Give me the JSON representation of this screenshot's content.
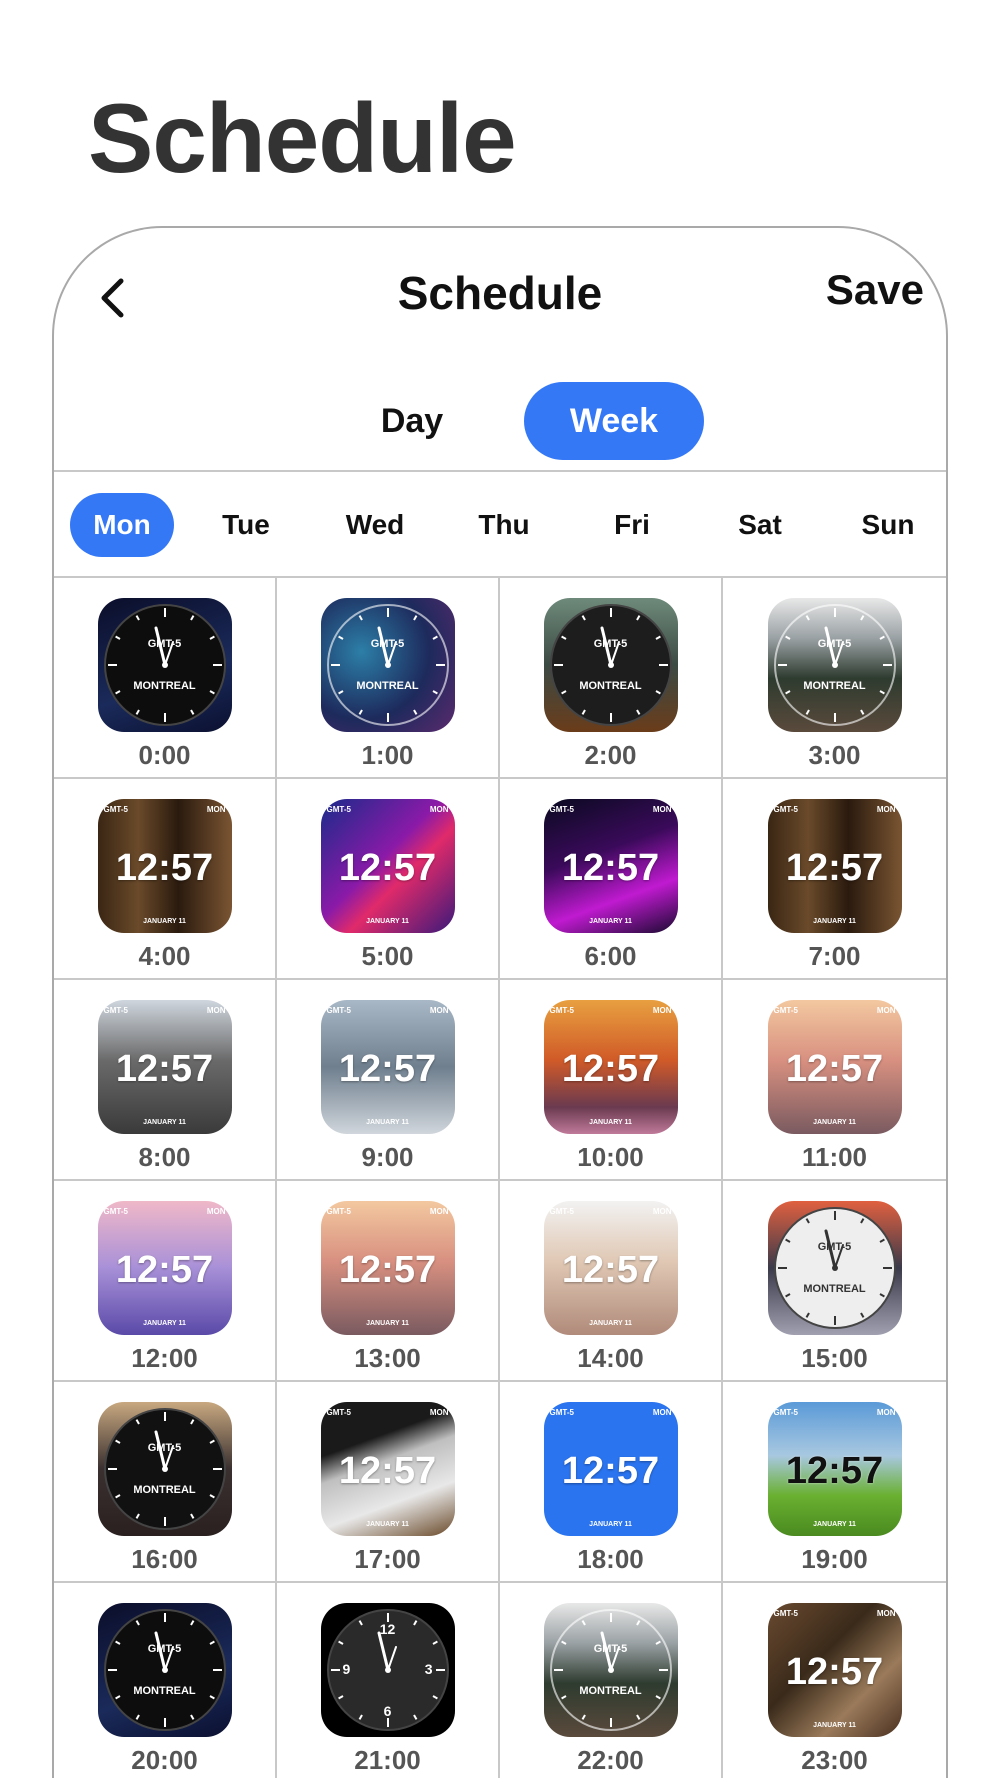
{
  "page_title": "Schedule",
  "nav": {
    "title": "Schedule",
    "save_label": "Save"
  },
  "segment": {
    "day_label": "Day",
    "week_label": "Week",
    "selected": "Week"
  },
  "days": [
    "Mon",
    "Tue",
    "Wed",
    "Thu",
    "Fri",
    "Sat",
    "Sun"
  ],
  "selected_day": "Mon",
  "face_text": {
    "zone": "GMT-5",
    "city": "MONTREAL",
    "city_short": "MON",
    "time": "12:57",
    "date": "JANUARY 11",
    "num_12": "12",
    "num_3": "3",
    "num_6": "6",
    "num_9": "9"
  },
  "slots": [
    {
      "time": "0:00",
      "style": "analog",
      "bg": "linear-gradient(160deg,#0b0e2a,#1a2a5a 60%,#0b1030)",
      "dial": "#0d0d0d"
    },
    {
      "time": "1:00",
      "style": "analog",
      "bg": "radial-gradient(circle at 30% 40%,#2c7fa8,#1d2a5c 55%,#5b2a6e)",
      "dial": "transparent"
    },
    {
      "time": "2:00",
      "style": "analog",
      "bg": "linear-gradient(180deg,#6e8a7a,#3c4a44 50%,#6a3c1a)",
      "dial": "#1d1d1d"
    },
    {
      "time": "3:00",
      "style": "analog",
      "bg": "linear-gradient(180deg,#e8e8e8 0%,#9aa1a4 30%,#2e3b2f 60%,#5a4a3c)",
      "dial": "transparent"
    },
    {
      "time": "4:00",
      "style": "digital",
      "bg": "linear-gradient(90deg,#3a2614,#6a4a2a 30%,#2a1a0e 60%,#7a5532)"
    },
    {
      "time": "5:00",
      "style": "digital",
      "bg": "linear-gradient(135deg,#1a2b8a,#8a1aa8 45%,#e02a6a 60%,#3a1a7a)"
    },
    {
      "time": "6:00",
      "style": "digital",
      "bg": "linear-gradient(160deg,#0a0a20,#3a0a5a 40%,#c01ad0 70%,#1a0a30)"
    },
    {
      "time": "7:00",
      "style": "digital",
      "bg": "linear-gradient(90deg,#3a2614,#6a4a2a 30%,#2a1a0e 60%,#7a5532)"
    },
    {
      "time": "8:00",
      "style": "digital",
      "bg": "linear-gradient(180deg,#cfd6de,#6a6a6a 45%,#3a3a3a)"
    },
    {
      "time": "9:00",
      "style": "digital",
      "bg": "linear-gradient(180deg,#a9b8c6,#6f7f8e 50%,#d0d6dc)"
    },
    {
      "time": "10:00",
      "style": "digital",
      "bg": "linear-gradient(180deg,#e8a040,#d05a28 45%,#6a3a50 80%,#c07a9a)"
    },
    {
      "time": "11:00",
      "style": "digital",
      "bg": "linear-gradient(180deg,#f3c8a0,#d89080 45%,#7a5a60)"
    },
    {
      "time": "12:00",
      "style": "digital",
      "bg": "linear-gradient(180deg,#f0b8c8,#a890d8 50%,#5a4aa8)"
    },
    {
      "time": "13:00",
      "style": "digital",
      "bg": "linear-gradient(180deg,#f3c8a0,#d89080 45%,#7a5a60)"
    },
    {
      "time": "14:00",
      "style": "digital",
      "bg": "linear-gradient(180deg,#f2f2f2,#e0c8b4 45%,#b08a7a)"
    },
    {
      "time": "15:00",
      "style": "analog",
      "bg": "linear-gradient(180deg,#e06040,#3a3a4a 50%,#a0a0b0)",
      "dial": "#eeeeee"
    },
    {
      "time": "16:00",
      "style": "analog",
      "bg": "linear-gradient(180deg,#c8a880,#3a3030 50%,#2a2020)",
      "dial": "#111111"
    },
    {
      "time": "17:00",
      "style": "digital",
      "bg": "linear-gradient(160deg,#1a1a1a 30%,#bfbfbf 45%,#e8e8e8 70%,#6a4a2a)"
    },
    {
      "time": "18:00",
      "style": "digital",
      "bg": "#2a74f0"
    },
    {
      "time": "19:00",
      "style": "digital",
      "bg": "linear-gradient(180deg,#5a9ad8,#a8c8e0 40%,#6ab030 70%,#4a8a20)",
      "dark": true
    },
    {
      "time": "20:00",
      "style": "analog",
      "bg": "linear-gradient(160deg,#0b0e2a,#1a2a5a 60%,#0b1030)",
      "dial": "#0d0d0d"
    },
    {
      "time": "21:00",
      "style": "analog",
      "bg": "#000000",
      "dial": "#2a2a2a",
      "numbers": true
    },
    {
      "time": "22:00",
      "style": "analog",
      "bg": "linear-gradient(180deg,#e8e8e8 0%,#9aa1a4 30%,#2e3b2f 60%,#5a4a3c)",
      "dial": "transparent"
    },
    {
      "time": "23:00",
      "style": "digital",
      "bg": "linear-gradient(135deg,#6a4a30,#3a2a1a 40%,#9a7a5a 70%,#4a3020)"
    }
  ]
}
